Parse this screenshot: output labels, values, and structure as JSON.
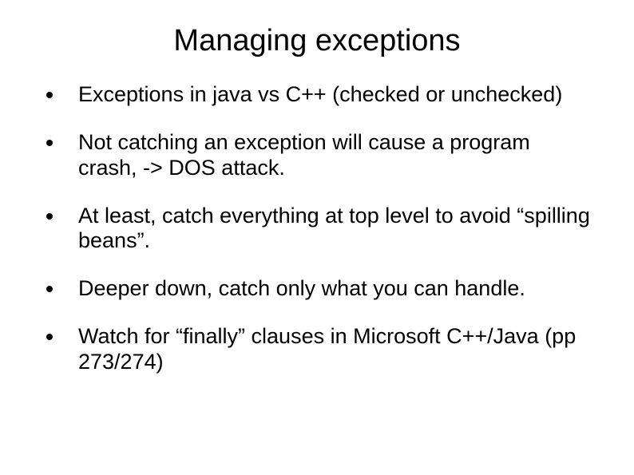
{
  "slide": {
    "title": "Managing exceptions",
    "bullets": [
      "Exceptions in java vs C++ (checked or unchecked)",
      "Not catching an exception will cause a program crash, -> DOS attack.",
      "At least, catch everything at top level to avoid “spilling beans”.",
      "Deeper down, catch only what you can handle.",
      "Watch for “finally” clauses in Microsoft C++/Java (pp 273/274)"
    ]
  }
}
